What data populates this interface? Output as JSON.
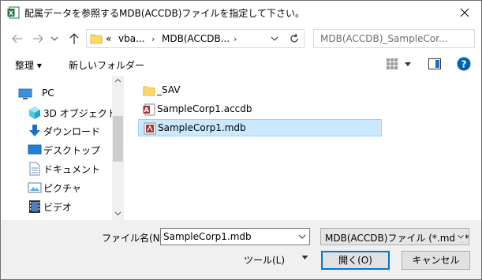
{
  "window": {
    "title": "配属データを参照するMDB(ACCDB)ファイルを指定して下さい。"
  },
  "address": {
    "crumbs": [
      "«",
      "vba...",
      "MDB(ACCDB..."
    ],
    "search_placeholder": "MDB(ACCDB)_SampleCor..."
  },
  "toolbar": {
    "organize_label": "整理 ▾",
    "new_folder_label": "新しいフォルダー"
  },
  "nav": {
    "items": [
      {
        "label": "PC",
        "icon": "pc-icon"
      },
      {
        "label": "3D オブジェクト",
        "icon": "3d-objects-icon"
      },
      {
        "label": "ダウンロード",
        "icon": "download-icon"
      },
      {
        "label": "デスクトップ",
        "icon": "desktop-icon"
      },
      {
        "label": "ドキュメント",
        "icon": "documents-icon"
      },
      {
        "label": "ピクチャ",
        "icon": "pictures-icon"
      },
      {
        "label": "ビデオ",
        "icon": "video-icon"
      }
    ]
  },
  "files": [
    {
      "name": "_SAV",
      "type": "folder"
    },
    {
      "name": "SampleCorp1.accdb",
      "type": "accdb"
    },
    {
      "name": "SampleCorp1.mdb",
      "type": "mdb",
      "selected": true
    }
  ],
  "footer": {
    "filename_label": "ファイル名(N):",
    "filename_value": "SampleCorp1.mdb",
    "filter_value": "MDB(ACCDB)ファイル (*.mdb;*.accdb)",
    "tools_label": "ツール(L)",
    "open_label": "開く(O)",
    "cancel_label": "キャンセル"
  },
  "colors": {
    "selection": "#cce8ff",
    "selection_border": "#99d1ff",
    "excel_green": "#1e7145",
    "folder_yellow": "#ffd866",
    "access_red": "#a4373a",
    "help_blue": "#0063b1"
  }
}
